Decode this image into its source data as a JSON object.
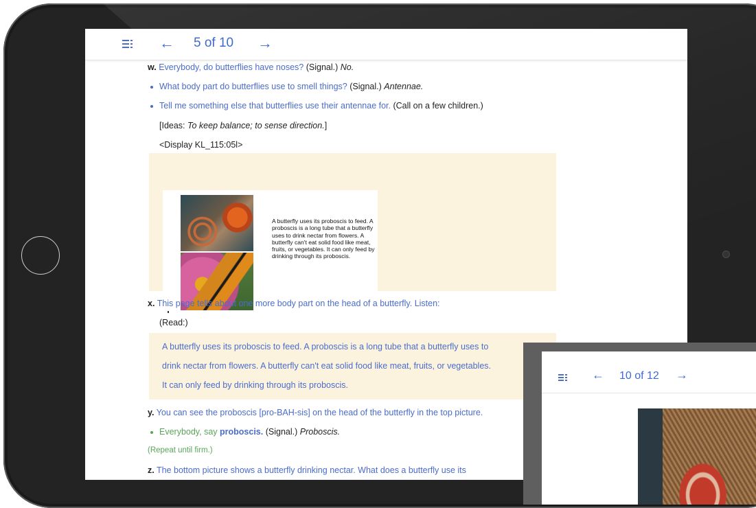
{
  "main_screen": {
    "nav": {
      "menu_icon": "menu-icon",
      "prev": "←",
      "next": "→",
      "page_counter": "5 of 10"
    },
    "w": {
      "letter": "w.",
      "question": "Everybody, do butterflies have noses?",
      "signal": "(Signal.)",
      "answer": "No.",
      "bullet1_question": "What body part do butterflies use to smell things?",
      "bullet1_signal": "(Signal.)",
      "bullet1_answer": "Antennae.",
      "bullet2_question": "Tell me something else that butterflies use their antennae for.",
      "bullet2_direction": "(Call on a few children.)",
      "ideas_prefix": "[Ideas:",
      "ideas_text": "To keep balance; to sense direction.",
      "ideas_suffix": "]",
      "display": "<Display KL_115:05l>"
    },
    "card": {
      "text": "A butterfly uses its proboscis to feed. A proboscis is a long tube that a butterfly uses to drink nectar from flowers. A butterfly can't eat solid food like meat, fruits, or vegetables. It can only feed by drinking through its proboscis."
    },
    "x": {
      "letter": "x.",
      "text": "This page tells about one more body part on the head of a butterfly. Listen:",
      "read": "(Read:)",
      "passage_line1": "A butterfly uses its proboscis to feed. A proboscis is a long tube that a butterfly uses to",
      "passage_line2": "drink nectar from flowers. A butterfly can't eat solid food like meat, fruits, or vegetables.",
      "passage_line3": "It can only feed by drinking through its proboscis."
    },
    "y": {
      "letter": "y.",
      "text": "You can see the proboscis [pro-BAH-sis] on the head of the butterfly in the top picture.",
      "say_prefix": "Everybody, say",
      "say_word": "proboscis.",
      "signal": "(Signal.)",
      "answer": "Proboscis.",
      "repeat": "(Repeat until firm.)"
    },
    "z": {
      "letter": "z.",
      "text": "The bottom picture shows a butterfly drinking nectar. What does a butterfly use its"
    }
  },
  "overlay_screen": {
    "nav": {
      "menu_icon": "menu-icon",
      "prev": "←",
      "next": "→",
      "page_counter": "10 of 12"
    }
  },
  "colors": {
    "accent_blue": "#4a6ccb",
    "nav_blue": "#3f6bd1",
    "tan_box": "#fcf3df",
    "green": "#5aa55a",
    "bezel": "#232323"
  }
}
